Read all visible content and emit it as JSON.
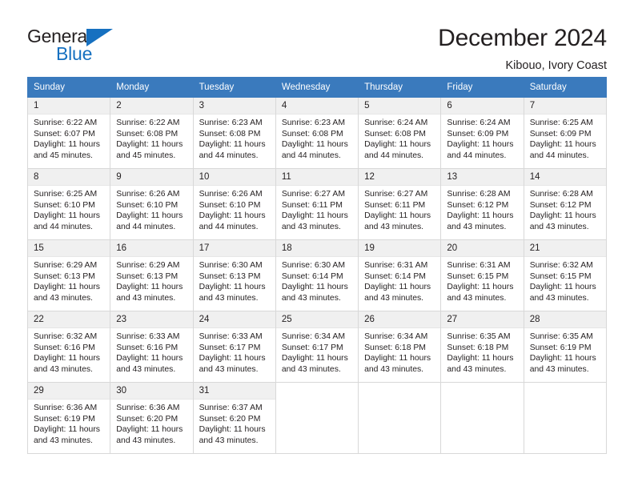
{
  "brand": {
    "name_line1": "General",
    "name_line2": "Blue",
    "accent_color": "#1670c0"
  },
  "header": {
    "title": "December 2024",
    "subtitle": "Kibouo, Ivory Coast"
  },
  "theme": {
    "header_blue": "#3a7abd",
    "daynum_background": "#f0f0f0",
    "border_color": "#d8d8d8",
    "text_color": "#231f20"
  },
  "labels": {
    "sunrise_prefix": "Sunrise:",
    "sunset_prefix": "Sunset:",
    "daylight_prefix": "Daylight:"
  },
  "weekday_headers": [
    "Sunday",
    "Monday",
    "Tuesday",
    "Wednesday",
    "Thursday",
    "Friday",
    "Saturday"
  ],
  "weeks": [
    [
      {
        "day": "1",
        "sunrise": "Sunrise: 6:22 AM",
        "sunset": "Sunset: 6:07 PM",
        "daylight": "Daylight: 11 hours and 45 minutes."
      },
      {
        "day": "2",
        "sunrise": "Sunrise: 6:22 AM",
        "sunset": "Sunset: 6:08 PM",
        "daylight": "Daylight: 11 hours and 45 minutes."
      },
      {
        "day": "3",
        "sunrise": "Sunrise: 6:23 AM",
        "sunset": "Sunset: 6:08 PM",
        "daylight": "Daylight: 11 hours and 44 minutes."
      },
      {
        "day": "4",
        "sunrise": "Sunrise: 6:23 AM",
        "sunset": "Sunset: 6:08 PM",
        "daylight": "Daylight: 11 hours and 44 minutes."
      },
      {
        "day": "5",
        "sunrise": "Sunrise: 6:24 AM",
        "sunset": "Sunset: 6:08 PM",
        "daylight": "Daylight: 11 hours and 44 minutes."
      },
      {
        "day": "6",
        "sunrise": "Sunrise: 6:24 AM",
        "sunset": "Sunset: 6:09 PM",
        "daylight": "Daylight: 11 hours and 44 minutes."
      },
      {
        "day": "7",
        "sunrise": "Sunrise: 6:25 AM",
        "sunset": "Sunset: 6:09 PM",
        "daylight": "Daylight: 11 hours and 44 minutes."
      }
    ],
    [
      {
        "day": "8",
        "sunrise": "Sunrise: 6:25 AM",
        "sunset": "Sunset: 6:10 PM",
        "daylight": "Daylight: 11 hours and 44 minutes."
      },
      {
        "day": "9",
        "sunrise": "Sunrise: 6:26 AM",
        "sunset": "Sunset: 6:10 PM",
        "daylight": "Daylight: 11 hours and 44 minutes."
      },
      {
        "day": "10",
        "sunrise": "Sunrise: 6:26 AM",
        "sunset": "Sunset: 6:10 PM",
        "daylight": "Daylight: 11 hours and 44 minutes."
      },
      {
        "day": "11",
        "sunrise": "Sunrise: 6:27 AM",
        "sunset": "Sunset: 6:11 PM",
        "daylight": "Daylight: 11 hours and 43 minutes."
      },
      {
        "day": "12",
        "sunrise": "Sunrise: 6:27 AM",
        "sunset": "Sunset: 6:11 PM",
        "daylight": "Daylight: 11 hours and 43 minutes."
      },
      {
        "day": "13",
        "sunrise": "Sunrise: 6:28 AM",
        "sunset": "Sunset: 6:12 PM",
        "daylight": "Daylight: 11 hours and 43 minutes."
      },
      {
        "day": "14",
        "sunrise": "Sunrise: 6:28 AM",
        "sunset": "Sunset: 6:12 PM",
        "daylight": "Daylight: 11 hours and 43 minutes."
      }
    ],
    [
      {
        "day": "15",
        "sunrise": "Sunrise: 6:29 AM",
        "sunset": "Sunset: 6:13 PM",
        "daylight": "Daylight: 11 hours and 43 minutes."
      },
      {
        "day": "16",
        "sunrise": "Sunrise: 6:29 AM",
        "sunset": "Sunset: 6:13 PM",
        "daylight": "Daylight: 11 hours and 43 minutes."
      },
      {
        "day": "17",
        "sunrise": "Sunrise: 6:30 AM",
        "sunset": "Sunset: 6:13 PM",
        "daylight": "Daylight: 11 hours and 43 minutes."
      },
      {
        "day": "18",
        "sunrise": "Sunrise: 6:30 AM",
        "sunset": "Sunset: 6:14 PM",
        "daylight": "Daylight: 11 hours and 43 minutes."
      },
      {
        "day": "19",
        "sunrise": "Sunrise: 6:31 AM",
        "sunset": "Sunset: 6:14 PM",
        "daylight": "Daylight: 11 hours and 43 minutes."
      },
      {
        "day": "20",
        "sunrise": "Sunrise: 6:31 AM",
        "sunset": "Sunset: 6:15 PM",
        "daylight": "Daylight: 11 hours and 43 minutes."
      },
      {
        "day": "21",
        "sunrise": "Sunrise: 6:32 AM",
        "sunset": "Sunset: 6:15 PM",
        "daylight": "Daylight: 11 hours and 43 minutes."
      }
    ],
    [
      {
        "day": "22",
        "sunrise": "Sunrise: 6:32 AM",
        "sunset": "Sunset: 6:16 PM",
        "daylight": "Daylight: 11 hours and 43 minutes."
      },
      {
        "day": "23",
        "sunrise": "Sunrise: 6:33 AM",
        "sunset": "Sunset: 6:16 PM",
        "daylight": "Daylight: 11 hours and 43 minutes."
      },
      {
        "day": "24",
        "sunrise": "Sunrise: 6:33 AM",
        "sunset": "Sunset: 6:17 PM",
        "daylight": "Daylight: 11 hours and 43 minutes."
      },
      {
        "day": "25",
        "sunrise": "Sunrise: 6:34 AM",
        "sunset": "Sunset: 6:17 PM",
        "daylight": "Daylight: 11 hours and 43 minutes."
      },
      {
        "day": "26",
        "sunrise": "Sunrise: 6:34 AM",
        "sunset": "Sunset: 6:18 PM",
        "daylight": "Daylight: 11 hours and 43 minutes."
      },
      {
        "day": "27",
        "sunrise": "Sunrise: 6:35 AM",
        "sunset": "Sunset: 6:18 PM",
        "daylight": "Daylight: 11 hours and 43 minutes."
      },
      {
        "day": "28",
        "sunrise": "Sunrise: 6:35 AM",
        "sunset": "Sunset: 6:19 PM",
        "daylight": "Daylight: 11 hours and 43 minutes."
      }
    ],
    [
      {
        "day": "29",
        "sunrise": "Sunrise: 6:36 AM",
        "sunset": "Sunset: 6:19 PM",
        "daylight": "Daylight: 11 hours and 43 minutes."
      },
      {
        "day": "30",
        "sunrise": "Sunrise: 6:36 AM",
        "sunset": "Sunset: 6:20 PM",
        "daylight": "Daylight: 11 hours and 43 minutes."
      },
      {
        "day": "31",
        "sunrise": "Sunrise: 6:37 AM",
        "sunset": "Sunset: 6:20 PM",
        "daylight": "Daylight: 11 hours and 43 minutes."
      },
      null,
      null,
      null,
      null
    ]
  ]
}
